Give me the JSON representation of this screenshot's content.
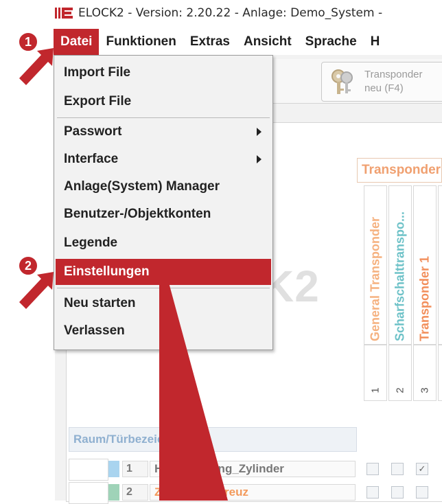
{
  "window": {
    "title": "ELOCK2 - Version: 2.20.22 - Anlage: Demo_System -"
  },
  "menubar": {
    "items": [
      "Datei",
      "Funktionen",
      "Extras",
      "Ansicht",
      "Sprache",
      "H"
    ]
  },
  "file_menu": {
    "import": "Import File",
    "export": "Export File",
    "password": "Passwort",
    "interface": "Interface",
    "system_manager": "Anlage(System) Manager",
    "accounts": "Benutzer-/Objektkonten",
    "legend": "Legende",
    "settings": "Einstellungen",
    "restart": "Neu starten",
    "exit": "Verlassen"
  },
  "toolbar": {
    "transponder_button": "Transponder\nneu (F4)"
  },
  "watermark": "K2",
  "grid": {
    "group_header": "Transponder",
    "columns": [
      {
        "label": "General Transponder",
        "number": "1",
        "color": "#f5b17f"
      },
      {
        "label": "Scharfschalttranspo...",
        "number": "2",
        "color": "#6ec2c8"
      },
      {
        "label": "Transponder 1",
        "number": "3",
        "color": "#f28e5a"
      }
    ],
    "room_header": "Raum/Türbezeichnung",
    "rows": [
      {
        "number": "1",
        "name": "Haupteingang_Zylinder",
        "swatch": "#a9d4ef",
        "checks": [
          false,
          false,
          true
        ],
        "name_color": "#777777"
      },
      {
        "number": "2",
        "name": "Zutritt/Drehkreuz",
        "swatch": "#9fd3b8",
        "checks": [
          false,
          false,
          false
        ],
        "name_color": "#f39a5c"
      }
    ]
  },
  "annotations": {
    "step1": "1",
    "step2": "2",
    "accent": "#c1272d"
  }
}
